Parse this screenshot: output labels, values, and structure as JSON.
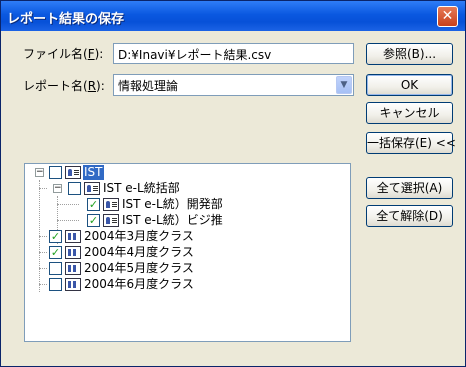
{
  "window": {
    "title": "レポート結果の保存",
    "close_icon": "close-icon"
  },
  "file": {
    "label": "ファイル名(",
    "key": "F",
    "label_end": "):",
    "value": "D:¥Inavi¥レポート結果.csv"
  },
  "report": {
    "label": "レポート名(",
    "key": "R",
    "label_end": "):",
    "value": "情報処理論"
  },
  "buttons": {
    "browse": "参照(B)...",
    "ok": "OK",
    "cancel": "キャンセル",
    "batch_save": "一括保存(E) <<",
    "select_all": "全て選択(A)",
    "deselect_all": "全て解除(D)"
  },
  "tree": [
    {
      "label": "IST",
      "checked": false,
      "icon": "person-icon",
      "expander": "−",
      "selected": true
    },
    {
      "label": "IST e-L統括部",
      "checked": false,
      "icon": "person-icon",
      "expander": "−"
    },
    {
      "label": "IST e-L統）開発部",
      "checked": true,
      "icon": "person-icon"
    },
    {
      "label": "IST e-L統）ビジ推",
      "checked": true,
      "icon": "person-icon"
    },
    {
      "label": "2004年3月度クラス",
      "checked": true,
      "icon": "group-icon"
    },
    {
      "label": "2004年4月度クラス",
      "checked": true,
      "icon": "group-icon"
    },
    {
      "label": "2004年5月度クラス",
      "checked": false,
      "icon": "group-icon"
    },
    {
      "label": "2004年6月度クラス",
      "checked": false,
      "icon": "group-icon"
    }
  ]
}
